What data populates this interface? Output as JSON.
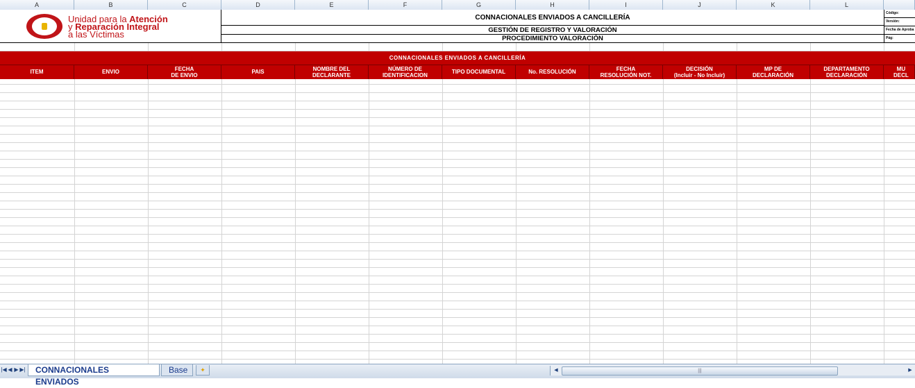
{
  "columns": [
    "A",
    "B",
    "C",
    "D",
    "E",
    "F",
    "G",
    "H",
    "I",
    "J",
    "K",
    "L"
  ],
  "logo": {
    "line1_regular": "Unidad para la ",
    "line1_bold": "Atención",
    "line2_regular": "y ",
    "line2_bold": "Reparación Integral",
    "line3": "a las Víctimas"
  },
  "header": {
    "title": "CONNACIONALES ENVIADOS A CANCILLERÍA",
    "subtitle1": "GESTIÓN DE REGISTRO Y VALORACIÓN",
    "subtitle2": "PROCEDIMIENTO VALORACIÓN",
    "meta": [
      "Código:",
      "Versión:",
      "Fecha de Aproba",
      "Pág:"
    ]
  },
  "table": {
    "band_title": "CONNACIONALES ENVIADOS A CANCILLERÍA",
    "headers": [
      "ITEM",
      "ENVIO",
      "FECHA\nDE ENVIO",
      "PAIS",
      "NOMBRE DEL\nDECLARANTE",
      "NÚMERO DE\nIDENTIFICACION",
      "TIPO DOCUMENTAL",
      "No. RESOLUCIÓN",
      "FECHA\nRESOLUCIÓN NOT.",
      "DECISIÓN\n(Incluir - No Incluir)",
      "MP DE\nDECLARACIÓN",
      "DEPARTAMENTO\nDECLARACIÓN",
      "MU\nDECL"
    ]
  },
  "tabs": {
    "active": "CONNACIONALES ENVIADOS",
    "other": "Base"
  },
  "colors": {
    "header_red": "#c00000",
    "logo_red": "#c01418",
    "tab_text": "#1a3b8c"
  }
}
